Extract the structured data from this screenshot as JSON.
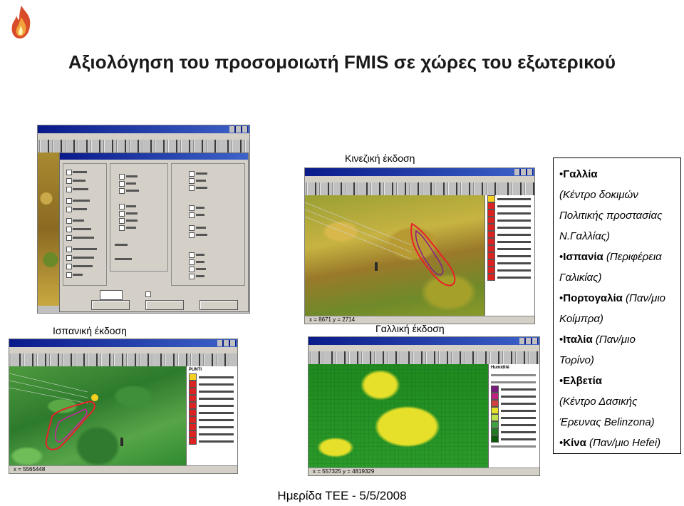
{
  "slide": {
    "title": "Αξιολόγηση του προσομοιωτή FMIS σε χώρες του εξωτερικού",
    "footer": "Ημερίδα ΤΕΕ - 5/5/2008"
  },
  "screenshots": {
    "chinese": {
      "caption": "Κινεζική  έκδοση",
      "status": "x = 8671 y = 2714"
    },
    "spanish": {
      "caption": "Ισπανική έκδοση",
      "status": "x = 5565448",
      "legend_title": "PUNTI"
    },
    "french": {
      "caption": "Γαλλική  έκδοση",
      "status": "x = 557325 y = 4819329",
      "legend_title": "Humidité"
    },
    "dialog": {
      "status": ""
    }
  },
  "countries": [
    {
      "bullet": "•",
      "name": "Γαλλία",
      "lines": [
        "(Κέντρο δοκιμών",
        "Πολιτικής προστασίας",
        "Ν.Γαλλίας)"
      ]
    },
    {
      "bullet": "•",
      "name": "Ισπανία",
      "inline": " (Περιφέρεια",
      "lines": [
        "Γαλικίας)"
      ]
    },
    {
      "bullet": "•",
      "name": "Πορτογαλία",
      "inline": " (Παν/μιο",
      "lines": [
        "Κοίμπρα)"
      ]
    },
    {
      "bullet": "•",
      "name": "Ιταλία",
      "inline": " (Παν/μιο",
      "lines": [
        "Τορίνο)"
      ]
    },
    {
      "bullet": "•",
      "name": "Ελβετία",
      "lines": [
        "(Κέντρο Δασικής",
        "Έρευνας Belinzona)"
      ]
    },
    {
      "bullet": "•",
      "name": "Κίνα",
      "inline": " (Παν/μιο Hefei)",
      "lines": []
    }
  ],
  "icons": [
    "flame-logo-icon"
  ],
  "colors": {
    "titlebar": "#0a1a8a",
    "fire_perimeter": "#e8202a",
    "terrain_green": "#2f8a2f",
    "map_yellow": "#e6e02a"
  }
}
